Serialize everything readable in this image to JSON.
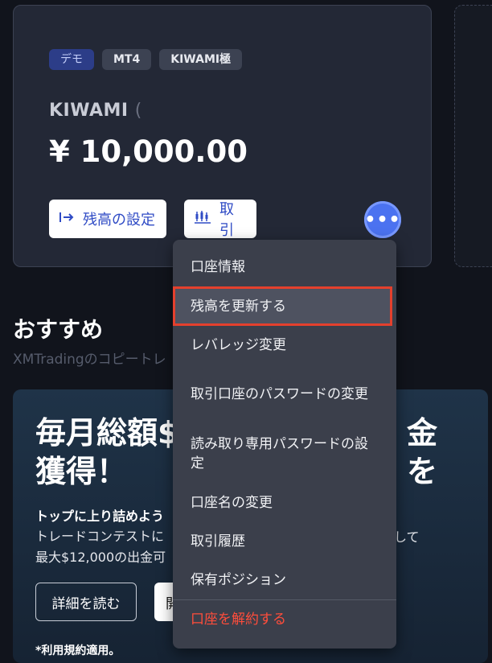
{
  "account": {
    "badges": [
      "デモ",
      "MT4",
      "KIWAMI極"
    ],
    "name": "KIWAMI",
    "name_cursor": "(",
    "balance": "¥ 10,000.00",
    "set_balance_label": "残高の設定",
    "trade_label": "取引",
    "more_label": "•••"
  },
  "recommend": {
    "title": "おすすめ",
    "subtitle": "XMTradingのコピートレ"
  },
  "promo": {
    "headline_line1": "毎月総額$",
    "headline_tail": "金を",
    "headline_line2": "獲得！",
    "bold_line": "トップに上り詰めよう",
    "text_line1": "トレードコンテストに",
    "text_line2": "最大$12,000の出金可",
    "text_right": "して",
    "details_button": "詳細を読む",
    "open_button": "開",
    "fine_print": "*利用規約適用。"
  },
  "menu": {
    "items": [
      "口座情報",
      "残高を更新する",
      "レバレッジ変更",
      "取引口座のパスワードの変更",
      "読み取り専用パスワードの設定",
      "口座名の変更",
      "取引履歴",
      "保有ポジション",
      "口座を解約する"
    ]
  },
  "colors": {
    "accent_blue": "#4b72f0",
    "danger_red": "#ff4d3b",
    "highlight_outline": "#e4402d"
  },
  "icons": {
    "set_balance": "arrow-to-bar-icon",
    "trade": "candlestick-chart-icon",
    "more": "more-dots-icon"
  }
}
